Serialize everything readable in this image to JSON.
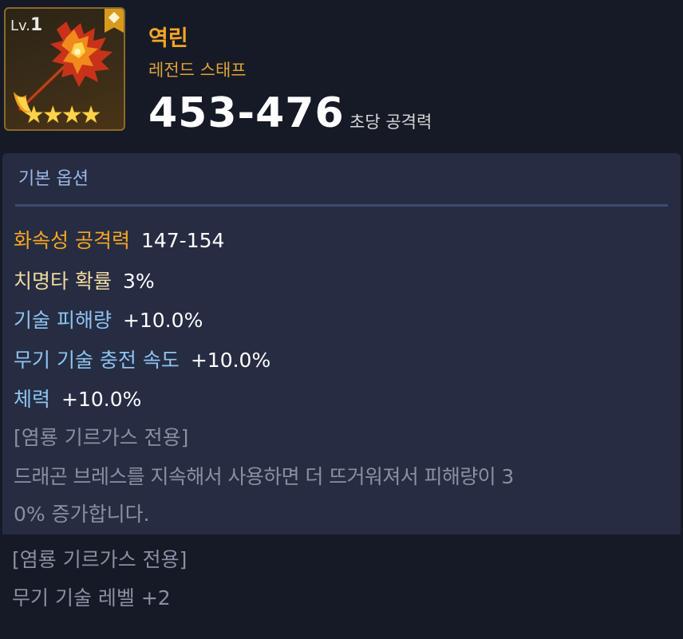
{
  "item": {
    "level_prefix": "Lv.",
    "level": "1",
    "stars": "★★★★",
    "name": "역린",
    "grade": "레전드 스태프",
    "damage": "453-476",
    "damage_label": "초당 공격력"
  },
  "colors": {
    "name": "#f5a623",
    "option_fire": "#f5a623",
    "option_crit": "#f0d9a0",
    "option_skill": "#8ec3f0",
    "option_hp": "#8ec3f0",
    "desc": "#8a8fa3"
  },
  "basic_options": {
    "title": "기본 옵션",
    "rows": [
      {
        "key": "화속성 공격력",
        "value": "147-154"
      },
      {
        "key": "치명타 확률",
        "value": "3%"
      },
      {
        "key": "기술 피해량",
        "value": "+10.0%"
      },
      {
        "key": "무기 기술 충전 속도",
        "value": "+10.0%"
      },
      {
        "key": "체력",
        "value": "+10.0%"
      }
    ],
    "exclusive_tag": "[염룡 기르가스 전용]",
    "exclusive_desc_line1": "드래곤 브레스를 지속해서 사용하면 더 뜨거워져서 피해량이 3",
    "exclusive_desc_line2": "0% 증가합니다."
  },
  "extra": {
    "exclusive_tag": "[염룡 기르가스 전용]",
    "bonus": "무기 기술 레벨 +2"
  }
}
